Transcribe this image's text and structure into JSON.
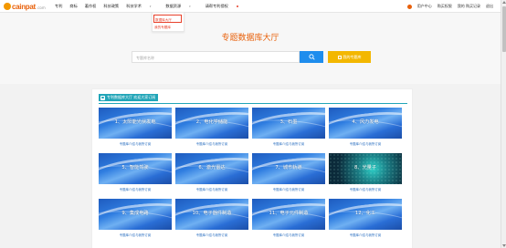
{
  "header": {
    "logo_text": "cainpat",
    "logo_domain": ".com",
    "nav": [
      {
        "label": "专利"
      },
      {
        "label": "商标"
      },
      {
        "label": "著作权"
      },
      {
        "label": "科技政策"
      },
      {
        "label": "科技学术"
      },
      {
        "label": "数据资源"
      },
      {
        "label": "请帮专利侵权"
      }
    ],
    "user": {
      "center": "用户中心",
      "vip": "购买权限",
      "recharge": "我的 购买记录",
      "logout": "退出"
    }
  },
  "dropdown": {
    "items": [
      "数据库大厅",
      "我的专题库"
    ]
  },
  "hero": {
    "title": "专题数据库大厅",
    "search_placeholder": "专题库名称",
    "my_button": "我的专题库"
  },
  "section": {
    "title": "专利数据库大厅 欢迎大家订阅"
  },
  "cards": [
    {
      "title": "1、太阳能光伏发电",
      "link_a": "专题库介绍",
      "link_b": "与我所订阅"
    },
    {
      "title": "2、电化学储能",
      "link_a": "专题库介绍",
      "link_b": "与我所订阅"
    },
    {
      "title": "3、石墨",
      "link_a": "专题库介绍",
      "link_b": "与我所订阅"
    },
    {
      "title": "4、风力发电",
      "link_a": "专题库介绍",
      "link_b": "与我所订阅"
    },
    {
      "title": "5、智能驾驶",
      "link_a": "专题库介绍",
      "link_b": "与我所订阅"
    },
    {
      "title": "6、激光雷达",
      "link_a": "专题库介绍",
      "link_b": "与我所订阅"
    },
    {
      "title": "7、城市轨道",
      "link_a": "专题库介绍",
      "link_b": "与我所订阅"
    },
    {
      "title": "8、光量子",
      "link_a": "专题库介绍",
      "link_b": "与我所订阅",
      "dark": true
    },
    {
      "title": "9、集成电路",
      "link_a": "专题库介绍",
      "link_b": "与我所订阅"
    },
    {
      "title": "10、电子器件制造",
      "link_a": "专题库介绍",
      "link_b": "与我所订阅"
    },
    {
      "title": "11、电子元件制造",
      "link_a": "专题库介绍",
      "link_b": "与我所订阅"
    },
    {
      "title": "12、化工",
      "link_a": "专题库介绍",
      "link_b": "与我所订阅"
    }
  ],
  "colors": {
    "brand": "#e8600a",
    "accent_blue": "#1f8ded",
    "accent_yellow": "#f3b700",
    "teal": "#21a5b8"
  }
}
